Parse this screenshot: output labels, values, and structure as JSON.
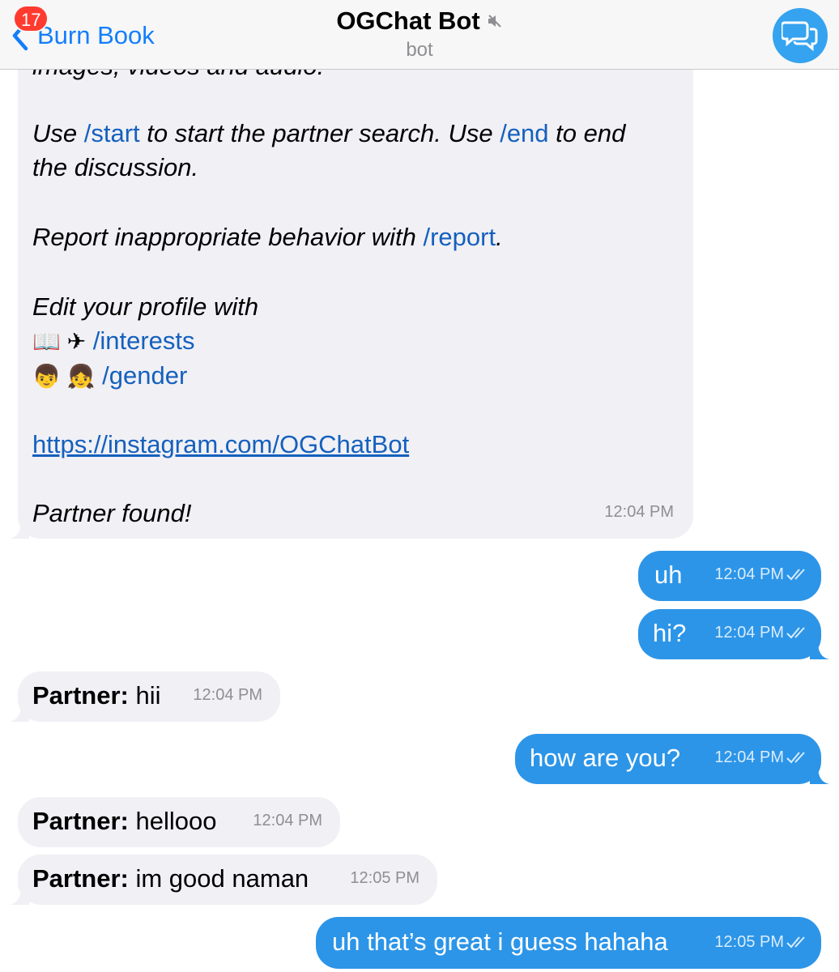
{
  "header": {
    "back_label": "Burn Book",
    "unread_badge": "17",
    "title": "OGChat Bot",
    "subtitle": "bot",
    "accent_color": "#147efb",
    "avatar_icon": "speech-bubbles-icon"
  },
  "bot_message": {
    "partial_line": "images, videos and audio.",
    "line1_pre": "Use ",
    "cmd_start": "/start",
    "line1_mid": " to start the partner search. Use ",
    "cmd_end": "/end",
    "line1_post": " to end",
    "line2": "the discussion.",
    "line3_pre": "Report inappropriate behavior with ",
    "cmd_report": "/report",
    "line3_post": ".",
    "line4": "Edit your profile with",
    "emoji_interests": "📖 ✈",
    "cmd_interests": "/interests",
    "emoji_gender": "👦 👧",
    "cmd_gender": "/gender",
    "link": "https://instagram.com/OGChatBot",
    "line_found": "Partner found!",
    "time": "12:04 PM"
  },
  "messages": [
    {
      "dir": "out",
      "text": "uh",
      "time": "12:04 PM"
    },
    {
      "dir": "out",
      "text": "hi?",
      "time": "12:04 PM"
    },
    {
      "dir": "in",
      "sender": "Partner:",
      "text": " hii",
      "time": "12:04 PM"
    },
    {
      "dir": "out",
      "text": "how are you?",
      "time": "12:04 PM"
    },
    {
      "dir": "in",
      "sender": "Partner:",
      "text": " hellooo",
      "time": "12:04 PM"
    },
    {
      "dir": "in",
      "sender": "Partner:",
      "text": " im good naman",
      "time": "12:05 PM"
    },
    {
      "dir": "out",
      "text": "uh that’s great i guess hahaha",
      "time": "12:05 PM"
    }
  ],
  "colors": {
    "incoming_bubble": "#f0f0f5",
    "outgoing_bubble": "#2c95e8",
    "link": "#1560bd",
    "badge": "#ff3b30"
  }
}
